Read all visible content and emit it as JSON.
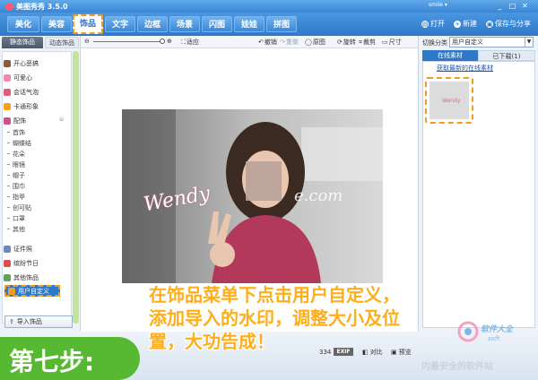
{
  "window": {
    "title": "美图秀秀 3.5.0",
    "user": "smile ▾",
    "controls": [
      "_",
      "□",
      "✕"
    ]
  },
  "menu": {
    "tabs": [
      "美化",
      "美容",
      "饰品",
      "文字",
      "边框",
      "场景",
      "闪图",
      "娃娃",
      "拼图"
    ],
    "active_tab": "饰品",
    "actions": [
      {
        "icon": "folder-icon",
        "label": "打开"
      },
      {
        "icon": "new-icon",
        "label": "新建"
      },
      {
        "icon": "save-icon",
        "label": "保存与分享"
      }
    ]
  },
  "toolbar": {
    "fit_label": "适应",
    "undo_label": "撤销",
    "redo_label": "重做",
    "original_label": "原图",
    "rotate_label": "旋转",
    "crop_label": "裁剪",
    "size_label": "尺寸"
  },
  "left_panel": {
    "tabs": [
      "静态饰品",
      "动态饰品"
    ],
    "categories": [
      {
        "label": "开心恶搞",
        "color": "#8a5a3a"
      },
      {
        "label": "可爱心",
        "color": "#f08ab0"
      },
      {
        "label": "会话气泡",
        "color": "#e05a7a"
      },
      {
        "label": "卡通形象",
        "color": "#f5a020"
      },
      {
        "label": "配饰",
        "color": "#d0508a"
      }
    ],
    "sub_items": [
      "首饰",
      "蝴蝶结",
      "花朵",
      "眼镜",
      "帽子",
      "围巾",
      "指甲",
      "创可贴",
      "口罩",
      "其他"
    ],
    "bottom_items": [
      {
        "label": "证件照",
        "color": "#6a8ac0"
      },
      {
        "label": "缤纷节日",
        "color": "#d85050"
      },
      {
        "label": "其他饰品",
        "color": "#60a060"
      },
      {
        "label": "用户自定义",
        "color": "#f0a020"
      }
    ],
    "import_label": "导入饰品"
  },
  "right_panel": {
    "category_label": "切换分类",
    "category_value": "用户自定义",
    "tabs": [
      "在线素材",
      "已下载(1)"
    ],
    "link": "获取最新的在线素材",
    "thumb_text": "Wendy"
  },
  "canvas": {
    "watermark_text": "Wendy",
    "watermark_tail": "e.com"
  },
  "status": {
    "width_value": "334",
    "exif": "EXIF",
    "contrast_label": "对比",
    "preview_label": "预览"
  },
  "annotation": {
    "lines": [
      "在饰品菜单下点击用户自定义，",
      "添加导入的水印，调整大小及位",
      "置，大功告成！"
    ],
    "step": "第七步:"
  },
  "watermarks": {
    "brand": "软件大全",
    "brand_sub": "soft",
    "site": "内最安全的软件站"
  }
}
